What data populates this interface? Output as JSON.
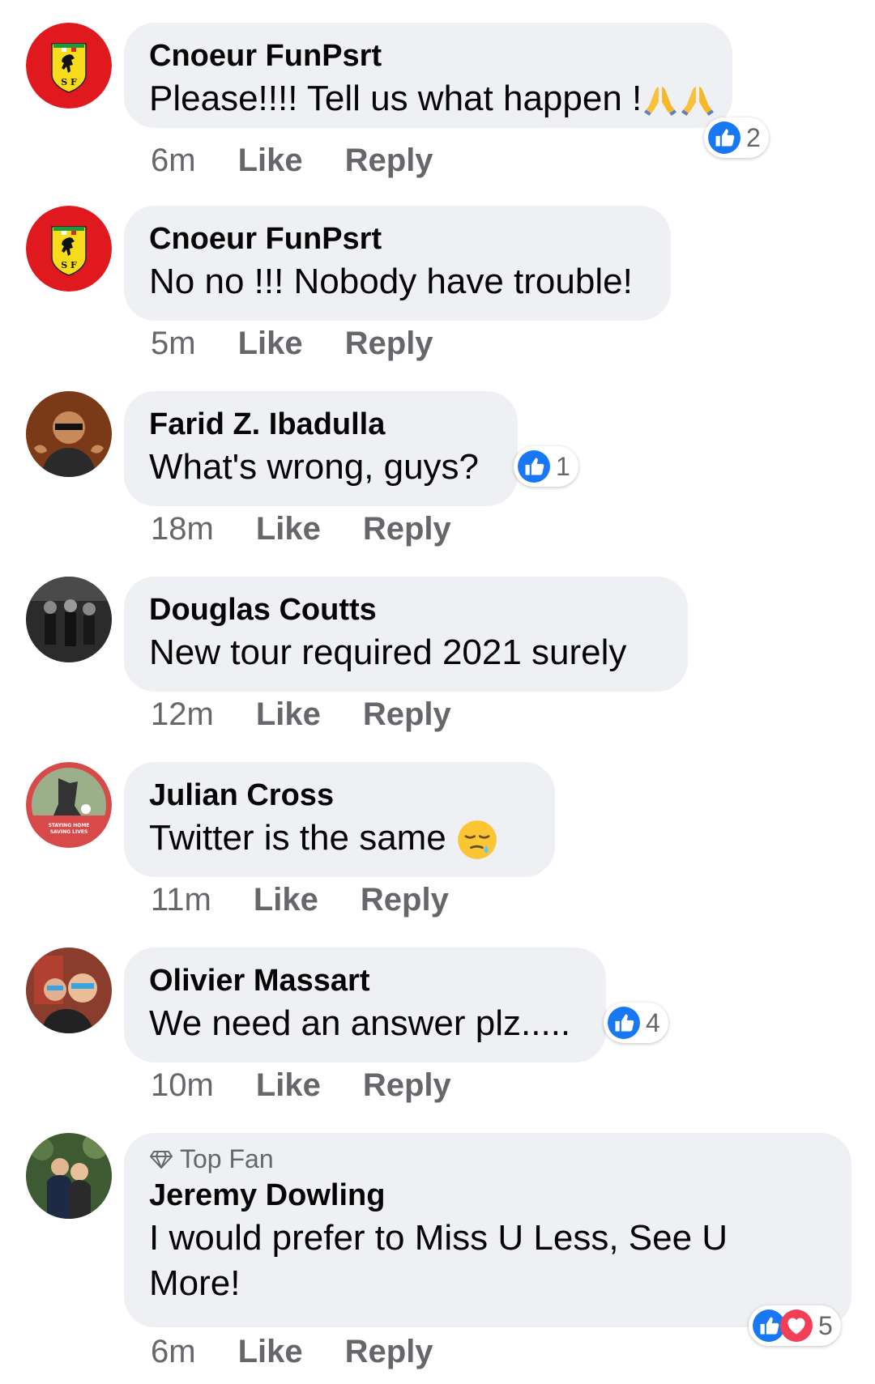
{
  "actions": {
    "like": "Like",
    "reply": "Reply"
  },
  "top_fan_label": "Top Fan",
  "colors": {
    "like_blue": "#1877f2",
    "love_red": "#f33e58",
    "bubble": "#eff0f3",
    "meta_gray": "#65676b"
  },
  "comments": [
    {
      "author": "Cnoeur FunPsrt",
      "text": "Please!!!! Tell us what happen !",
      "emoji": "folded-hands-icon x2",
      "time": "6m",
      "reactions": "2",
      "avatar": "ferrari-logo"
    },
    {
      "author": "Cnoeur FunPsrt",
      "text": "No no !!! Nobody have trouble!",
      "time": "5m",
      "avatar": "ferrari-logo"
    },
    {
      "author": "Farid Z. Ibadulla",
      "text": "What's wrong, guys?",
      "time": "18m",
      "reactions": "1",
      "avatar": "photo"
    },
    {
      "author": "Douglas Coutts",
      "text": "New tour required 2021 surely",
      "time": "12m",
      "avatar": "photo"
    },
    {
      "author": "Julian Cross",
      "text": "Twitter is the same",
      "emoji": "sleepy-face-icon",
      "time": "11m",
      "avatar": "staying-home-frame"
    },
    {
      "author": "Olivier Massart",
      "text": "We need an answer plz.....",
      "time": "10m",
      "reactions": "4",
      "avatar": "photo"
    },
    {
      "author": "Jeremy Dowling",
      "text": "I would prefer to Miss U Less, See U More!",
      "time": "6m",
      "reactions": "5",
      "avatar": "photo",
      "top_fan": true
    }
  ]
}
